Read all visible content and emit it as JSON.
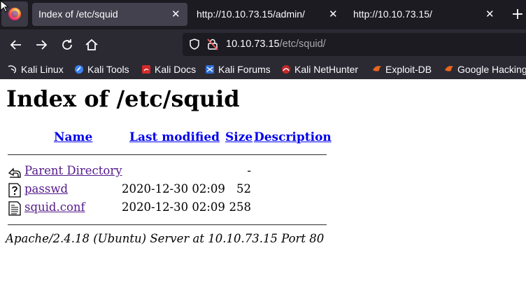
{
  "browser": {
    "tabs": [
      {
        "label": "Index of /etc/squid",
        "active": true
      },
      {
        "label": "http://10.10.73.15/admin/",
        "active": false
      },
      {
        "label": "http://10.10.73.15/",
        "active": false
      }
    ],
    "close_glyph": "✕",
    "new_tab_glyph": "+",
    "url_host": "10.10.73.15",
    "url_path": "/etc/squid/",
    "bookmarks": [
      {
        "label": "Kali Linux",
        "icon": "kali-dragon-icon"
      },
      {
        "label": "Kali Tools",
        "icon": "kali-tools-icon"
      },
      {
        "label": "Kali Docs",
        "icon": "kali-docs-icon"
      },
      {
        "label": "Kali Forums",
        "icon": "kali-forums-icon"
      },
      {
        "label": "Kali NetHunter",
        "icon": "kali-nethunter-icon"
      },
      {
        "label": "Exploit-DB",
        "icon": "exploit-db-icon"
      },
      {
        "label": "Google Hacking",
        "icon": "google-hacking-icon"
      }
    ],
    "accent": "#1c1b22"
  },
  "page": {
    "title": "Index of /etc/squid",
    "columns": {
      "name": "Name",
      "last_modified": "Last modified",
      "size": "Size",
      "description": "Description"
    },
    "rows": [
      {
        "name": "Parent Directory",
        "modified": "",
        "size": "-",
        "icon": "back-folder-icon"
      },
      {
        "name": "passwd",
        "modified": "2020-12-30 02:09",
        "size": "52",
        "icon": "unknown-file-icon"
      },
      {
        "name": "squid.conf",
        "modified": "2020-12-30 02:09",
        "size": "258",
        "icon": "text-file-icon"
      }
    ],
    "address": "Apache/2.4.18 (Ubuntu) Server at 10.10.73.15 Port 80"
  }
}
